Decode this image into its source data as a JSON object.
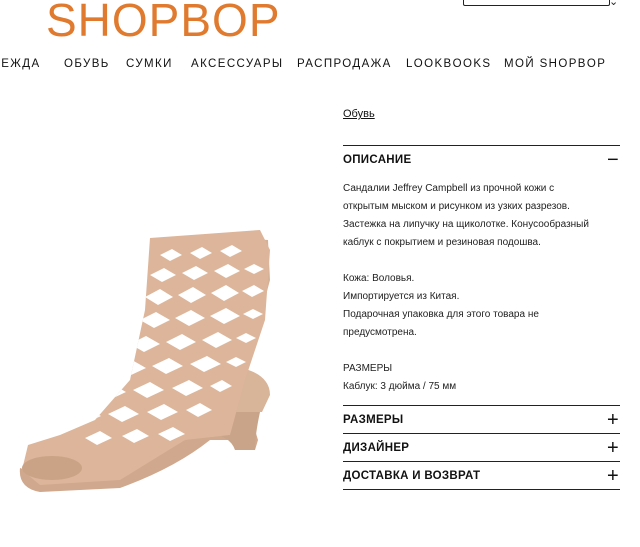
{
  "header": {
    "logo": "SHOPBOP"
  },
  "nav": {
    "items": [
      "ДЕЖДА",
      "ОБУВЬ",
      "СУМКИ",
      "АКСЕССУАРЫ",
      "РАСПРОДАЖА",
      "LOOKBOOKS",
      "МОЙ SHOPBOP"
    ]
  },
  "product": {
    "breadcrumb": "Обувь",
    "description_title": "ОПИСАНИЕ",
    "description_lines": [
      "Сандалии Jeffrey Campbell из прочной кожи с",
      "открытым мыском и рисунком из узких разрезов.",
      "Застежка на липучку на щиколотке. Конусообразный",
      "каблук с покрытием и резиновая подошва."
    ],
    "material": "Кожа: Воловья.",
    "origin": "Импортируется из Китая.",
    "gift_line1": "Подарочная упаковка для этого товара не",
    "gift_line2": "предусмотрена.",
    "sizes_caption": "РАЗМЕРЫ",
    "heel": "Каблук: 3 дюйма / 75 мм"
  },
  "accordion": [
    {
      "label": "РАЗМЕРЫ",
      "icon": "plus-icon"
    },
    {
      "label": "ДИЗАЙНЕР",
      "icon": "plus-icon"
    },
    {
      "label": "ДОСТАВКА И ВОЗВРАТ",
      "icon": "plus-icon"
    }
  ],
  "colors": {
    "brand": "#e07a2e",
    "sandal": "#dcb59a",
    "text": "#111111"
  }
}
